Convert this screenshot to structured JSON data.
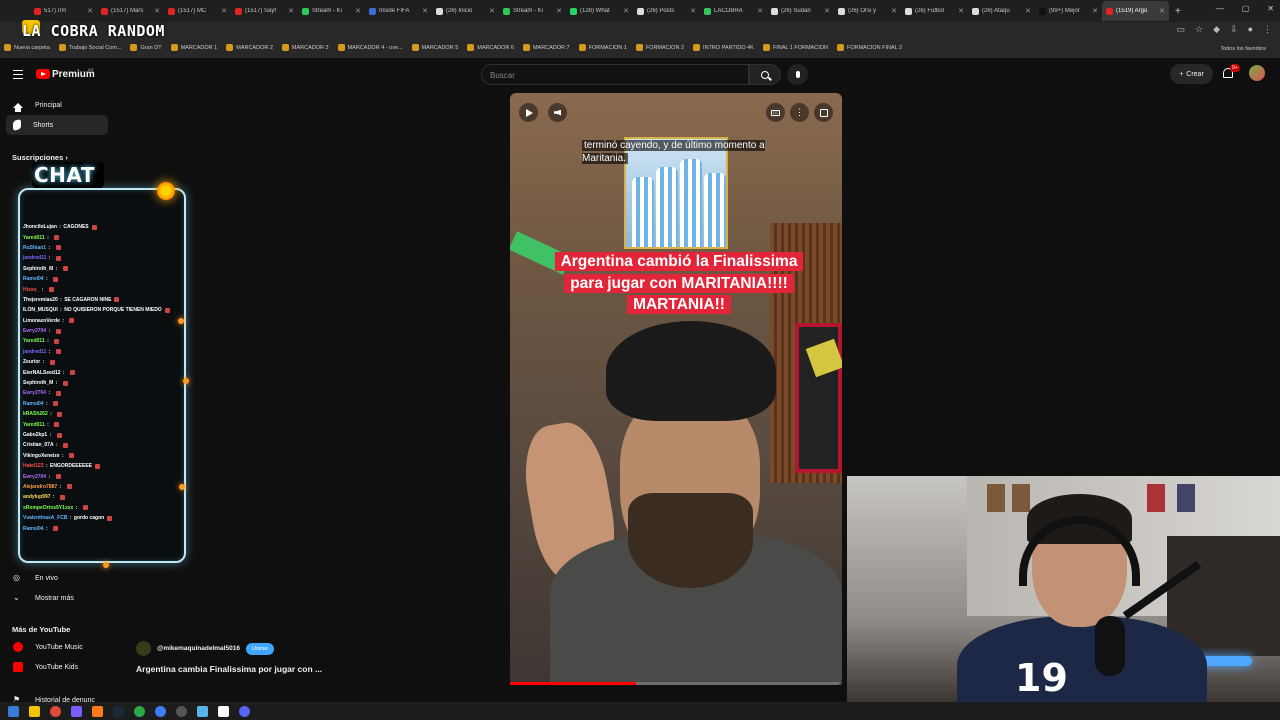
{
  "browser": {
    "tabs": [
      {
        "label": "517) ЛЯ",
        "color": "#e02424"
      },
      {
        "label": "(1517) Mars",
        "color": "#e02424"
      },
      {
        "label": "(1517) MC",
        "color": "#e02424"
      },
      {
        "label": "(1517) Sayf",
        "color": "#e02424"
      },
      {
        "label": "Stream - Ki",
        "color": "#31c75a"
      },
      {
        "label": "Inside FIFA",
        "color": "#3b6fd8"
      },
      {
        "label": "(26) Inicio",
        "color": "#dddddd"
      },
      {
        "label": "Stream - Ki",
        "color": "#31c75a"
      },
      {
        "label": "(128) What",
        "color": "#25d366"
      },
      {
        "label": "(26) Posts",
        "color": "#dddddd"
      },
      {
        "label": "LACOBRA",
        "color": "#31c75a"
      },
      {
        "label": "(26) Sudan",
        "color": "#dddddd"
      },
      {
        "label": "(26) Orsi y",
        "color": "#dddddd"
      },
      {
        "label": "(26) Futbol",
        "color": "#dddddd"
      },
      {
        "label": "(26) Ataqu",
        "color": "#dddddd"
      },
      {
        "label": "(99+) Mejor",
        "color": "#111111"
      },
      {
        "label": "(1519) Argo",
        "color": "#e02424",
        "active": true
      }
    ],
    "bookmarks": [
      "Nueva carpeta",
      "Trabajo Social Com...",
      "Gran DT",
      "MARCADOR 1",
      "MARCADOR 2",
      "MARCADOR 3",
      "MARCADOR 4 - ove...",
      "MARCADOR 5",
      "MARCADOR 6",
      "MARCADOR 7",
      "FORMACION 1",
      "FORMACION 2",
      "INTRO PARTIDO 4K",
      "FINAL 1 FORMACION",
      "FORMACION FINAL 2"
    ],
    "all_bookmarks": "Todos los favoritos"
  },
  "overlay": {
    "title": "LA COBRA RANDOM",
    "chat_title": "CHAT"
  },
  "masthead": {
    "brand": "Premium",
    "country": "AR",
    "search_placeholder": "Buscar",
    "create_label": "Crear",
    "notif_count": "9+"
  },
  "sidebar": {
    "home": "Principal",
    "shorts": "Shorts",
    "subscriptions": "Suscripciones",
    "live": "En vivo",
    "show_more": "Mostrar más",
    "more_from": "Más de YouTube",
    "yt_music": "YouTube Music",
    "yt_kids": "YouTube Kids",
    "history": "Historial de denunc"
  },
  "chat": [
    {
      "user": "JhonciloLujan",
      "msg": "CAGONES",
      "color": "#ffffff"
    },
    {
      "user": "Yared011",
      "msg": "",
      "color": "#7dff4f"
    },
    {
      "user": "RuShian1",
      "msg": "",
      "color": "#5fb7ff"
    },
    {
      "user": "jandred11",
      "msg": "",
      "color": "#7a6dff"
    },
    {
      "user": "Sephiroth_M",
      "msg": "",
      "color": "#ffffff"
    },
    {
      "user": "Ramsi04",
      "msg": "",
      "color": "#5fb7ff"
    },
    {
      "user": "Hisso_",
      "msg": "",
      "color": "#ff4f4f"
    },
    {
      "user": "Thejeremias20",
      "msg": "SE CAGARON NINE",
      "color": "#ffffff"
    },
    {
      "user": "ILON_MUSQUI",
      "msg": "NO QUISIERON PORQUE TIENEN MIEDO",
      "color": "#ffffff"
    },
    {
      "user": "LimonazoVerde",
      "msg": "",
      "color": "#ffffff"
    },
    {
      "user": "Ewry2704",
      "msg": "",
      "color": "#b46dff"
    },
    {
      "user": "Yared011",
      "msg": "",
      "color": "#7dff4f"
    },
    {
      "user": "jandred11",
      "msg": "",
      "color": "#7a6dff"
    },
    {
      "user": "Zeurior",
      "msg": "",
      "color": "#ffffff"
    },
    {
      "user": "EterNALSeed12",
      "msg": "",
      "color": "#ffffff"
    },
    {
      "user": "Sephiroth_M",
      "msg": "",
      "color": "#ffffff"
    },
    {
      "user": "Ewry2704",
      "msg": "",
      "color": "#b46dff"
    },
    {
      "user": "Ramsi04",
      "msg": "",
      "color": "#5fb7ff"
    },
    {
      "user": "kRASh262",
      "msg": "",
      "color": "#7dff4f"
    },
    {
      "user": "Yared011",
      "msg": "",
      "color": "#7dff4f"
    },
    {
      "user": "Gabo2kp1",
      "msg": "",
      "color": "#ffffff"
    },
    {
      "user": "Cristian_07A",
      "msg": "",
      "color": "#ffffff"
    },
    {
      "user": "VikingoXeneize",
      "msg": "",
      "color": "#ffffff"
    },
    {
      "user": "Hatel123",
      "msg": "ENGORDEEEEEE",
      "color": "#ff4f4f"
    },
    {
      "user": "Ewry2704",
      "msg": "",
      "color": "#b46dff"
    },
    {
      "user": "Alejandro7887",
      "msg": "",
      "color": "#ff9a3c"
    },
    {
      "user": "andylup997",
      "msg": "",
      "color": "#ffdd55"
    },
    {
      "user": "xRompeOrtos9Y1xxx",
      "msg": "",
      "color": "#7dff4f"
    },
    {
      "user": "VvalentinasA_FCB",
      "msg": "gordo cagon",
      "color": "#5fb7ff"
    },
    {
      "user": "Ramsi04",
      "msg": "",
      "color": "#5fb7ff"
    }
  ],
  "video": {
    "caption_top": "terminó cayendo, y de último momento a Maritania.",
    "headline": "Argentina cambió la Finalissima para jugar con MARITANIA!!!! MARTANIA!!",
    "progress_fraction": 0.38,
    "channel": "@mikemaquinadelmal5016",
    "join_label": "Unirse",
    "title": "Argentina cambia Finalissima por jugar con ..."
  },
  "webcam": {
    "jersey_number": "19"
  }
}
